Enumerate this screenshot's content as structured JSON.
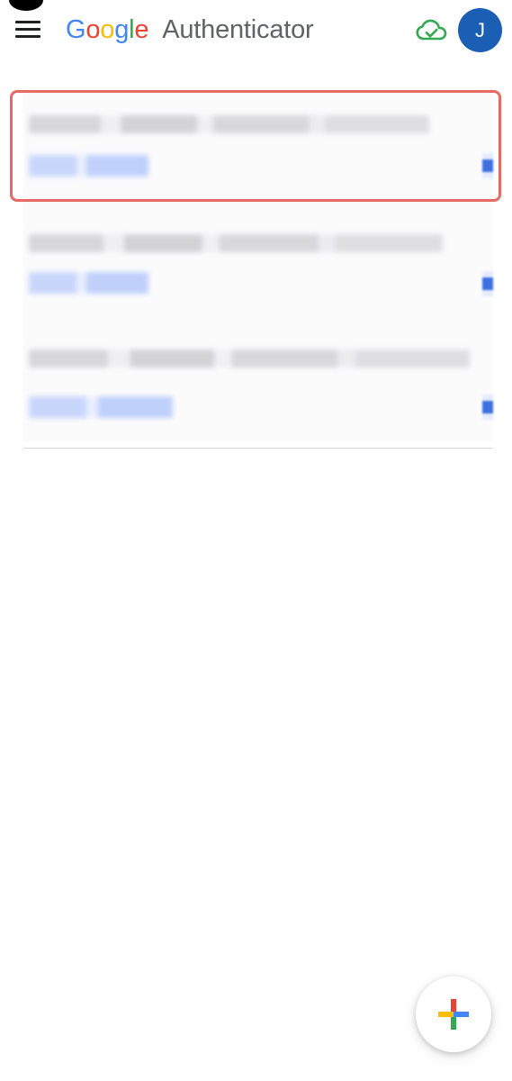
{
  "app": {
    "brand_letters": [
      "G",
      "o",
      "o",
      "g",
      "l",
      "e"
    ],
    "product_name": "Authenticator",
    "sync_icon": "cloud-check-icon",
    "avatar_initial": "J"
  },
  "colors": {
    "google_blue": "#4285f4",
    "google_red": "#ea4335",
    "google_yellow": "#fbbc05",
    "google_green": "#34a853",
    "highlight_outline": "#e46a63",
    "avatar_bg": "#1a5fb4"
  },
  "accounts": [
    {
      "highlighted": true
    },
    {
      "highlighted": false
    },
    {
      "highlighted": false
    }
  ],
  "fab": {
    "icon": "plus-icon"
  }
}
